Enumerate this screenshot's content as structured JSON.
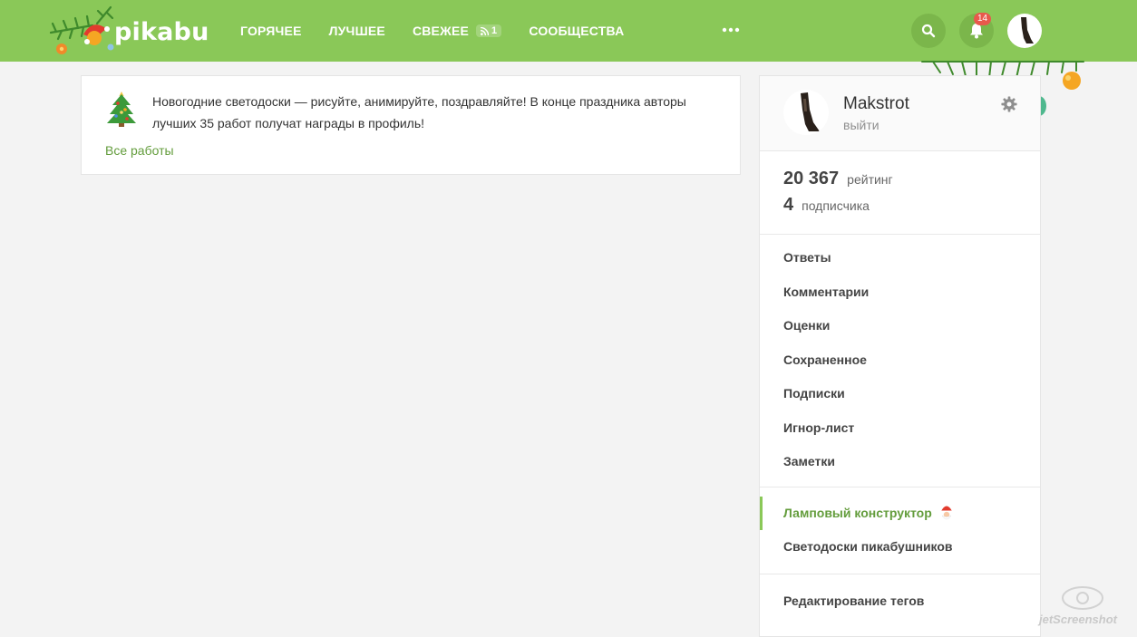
{
  "header": {
    "logo_text": "pikabu",
    "nav": [
      {
        "label": "ГОРЯЧЕЕ"
      },
      {
        "label": "ЛУЧШЕЕ"
      },
      {
        "label": "СВЕЖЕЕ",
        "badge": "1"
      },
      {
        "label": "СООБЩЕСТВА"
      }
    ],
    "notifications_count": "14"
  },
  "banner": {
    "text": "Новогодние светодоски — рисуйте, анимируйте, поздравляйте! В конце праздника авторы лучших 35 работ получат награды в профиль!",
    "link": "Все работы"
  },
  "profile": {
    "username": "Makstrot",
    "logout": "выйти",
    "rating_value": "20 367",
    "rating_label": "рейтинг",
    "subscribers_value": "4",
    "subscribers_label": "подписчика"
  },
  "menu": {
    "items": [
      "Ответы",
      "Комментарии",
      "Оценки",
      "Сохраненное",
      "Подписки",
      "Игнор-лист",
      "Заметки"
    ],
    "section2": [
      "Ламповый конструктор",
      "Светодоски пикабушников"
    ],
    "section3": [
      "Редактирование тегов"
    ]
  },
  "colors": {
    "header": "#8ac858",
    "accent_link": "#649d3d",
    "badge": "#e8594c"
  },
  "watermark": "jetScreenshot"
}
